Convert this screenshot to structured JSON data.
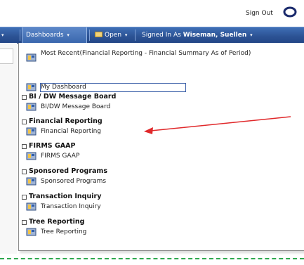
{
  "header": {
    "sign_out_label": "Sign Out",
    "sign_out_icon": "oracle-o-icon"
  },
  "navbar": {
    "dashboards_label": "Dashboards",
    "open_label": "Open",
    "signed_in_label": "Signed In As",
    "user_name": "Wiseman, Suellen"
  },
  "menu": {
    "most_recent": "Most Recent(Financial Reporting - Financial Summary As of Period)",
    "my_dashboard": "My Dashboard",
    "sections": [
      {
        "title": "BI / DW Message Board",
        "item": "BI/DW Message Board"
      },
      {
        "title": "Financial Reporting",
        "item": "Financial Reporting"
      },
      {
        "title": "FIRMS GAAP",
        "item": "FIRMS GAAP"
      },
      {
        "title": "Sponsored Programs",
        "item": "Sponsored Programs"
      },
      {
        "title": "Transaction Inquiry",
        "item": "Transaction Inquiry"
      },
      {
        "title": "Tree Reporting",
        "item": "Tree Reporting"
      }
    ]
  },
  "colors": {
    "navbar": "#2d5496",
    "arrow": "#e0282a",
    "dashed": "#2fa84f"
  }
}
